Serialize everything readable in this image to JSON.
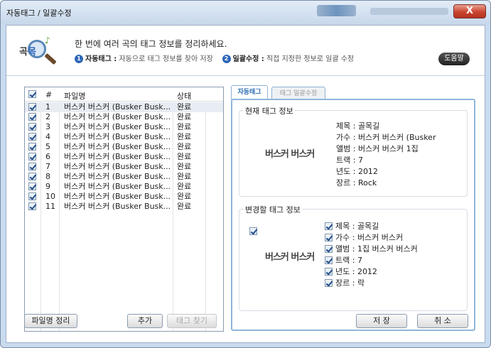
{
  "window": {
    "title": "자동태그 / 일괄수정",
    "close_label": "X"
  },
  "header": {
    "logo_text": "곡",
    "logo_text2": "목",
    "main_text": "한 번에 여러 곡의 태그 정보를 정리하세요.",
    "step1_num": "1",
    "step1_title": "자동태그 :",
    "step1_desc": "자동으로 태그 정보를 찾아 저장",
    "step2_num": "2",
    "step2_title": "일괄수정 :",
    "step2_desc": "직접 지정한 정보로 일괄 수정",
    "help_label": "도움말"
  },
  "file_list": {
    "columns": [
      "#",
      "파일명",
      "상태"
    ],
    "header_checked": true,
    "rows": [
      {
        "num": "1",
        "name": "버스커 버스커 (Busker Busk...",
        "status": "완료",
        "checked": true
      },
      {
        "num": "2",
        "name": "버스커 버스커 (Busker Busk...",
        "status": "완료",
        "checked": true
      },
      {
        "num": "3",
        "name": "버스커 버스커 (Busker Busk...",
        "status": "완료",
        "checked": true
      },
      {
        "num": "4",
        "name": "버스커 버스커 (Busker Busk...",
        "status": "완료",
        "checked": true
      },
      {
        "num": "5",
        "name": "버스커 버스커 (Busker Busk...",
        "status": "완료",
        "checked": true
      },
      {
        "num": "6",
        "name": "버스커 버스커 (Busker Busk...",
        "status": "완료",
        "checked": true
      },
      {
        "num": "7",
        "name": "버스커 버스커 (Busker Busk...",
        "status": "완료",
        "checked": true
      },
      {
        "num": "8",
        "name": "버스커 버스커 (Busker Busk...",
        "status": "완료",
        "checked": true
      },
      {
        "num": "9",
        "name": "버스커 버스커 (Busker Busk...",
        "status": "완료",
        "checked": true
      },
      {
        "num": "10",
        "name": "버스커 버스커 (Busker Busk...",
        "status": "완료",
        "checked": true
      },
      {
        "num": "11",
        "name": "버스커 버스커 (Busker Busk...",
        "status": "완료",
        "checked": true
      }
    ]
  },
  "buttons": {
    "rename": "파일명 정리",
    "add": "추가",
    "find_tags": "태그 찾기",
    "save": "저 장",
    "cancel": "취 소"
  },
  "tabs": [
    {
      "label": "자동태그",
      "active": true
    },
    {
      "label": "태그 일괄수정",
      "active": false
    }
  ],
  "current_tag": {
    "title": "현재 태그 정보",
    "album_art": "버스커 버스커",
    "lines": [
      "제목 : 골목길",
      "가수 : 버스커 버스커 (Busker",
      "앨범 : 버스커 버스커 1집",
      "트랙 : 7",
      "년도 : 2012",
      "장르 : Rock"
    ]
  },
  "new_tag": {
    "title": "변경할 태그 정보",
    "art_checked": true,
    "album_art": "버스커 버스커",
    "fields": [
      {
        "label": "제목 : 골목길",
        "checked": true
      },
      {
        "label": "가수 : 버스커 버스커",
        "checked": true
      },
      {
        "label": "앨범 : 1집 버스커 버스커",
        "checked": true
      },
      {
        "label": "트랙 : 7",
        "checked": true
      },
      {
        "label": "년도 : 2012",
        "checked": true
      },
      {
        "label": "장르 : 락",
        "checked": true
      }
    ]
  }
}
